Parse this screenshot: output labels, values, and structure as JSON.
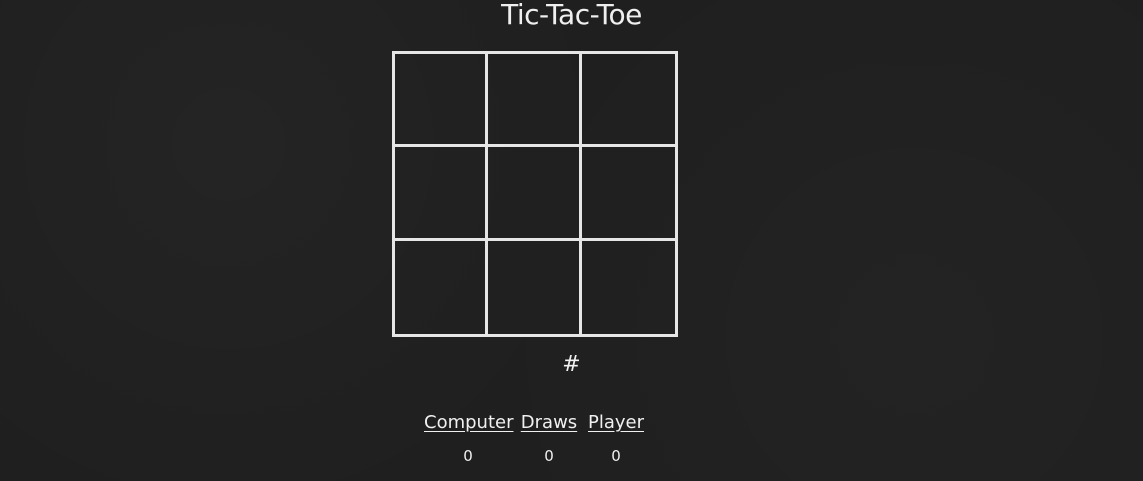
{
  "title": "Tic-Tac-Toe",
  "board": {
    "cells": [
      "",
      "",
      "",
      "",
      "",
      "",
      "",
      "",
      ""
    ]
  },
  "turn_indicator": "#",
  "scoreboard": {
    "headers": [
      "Computer",
      "Draws",
      "Player"
    ],
    "values": [
      "0",
      "0",
      "0"
    ]
  },
  "colors": {
    "background": "#1f1f1f",
    "foreground": "#ececec"
  }
}
